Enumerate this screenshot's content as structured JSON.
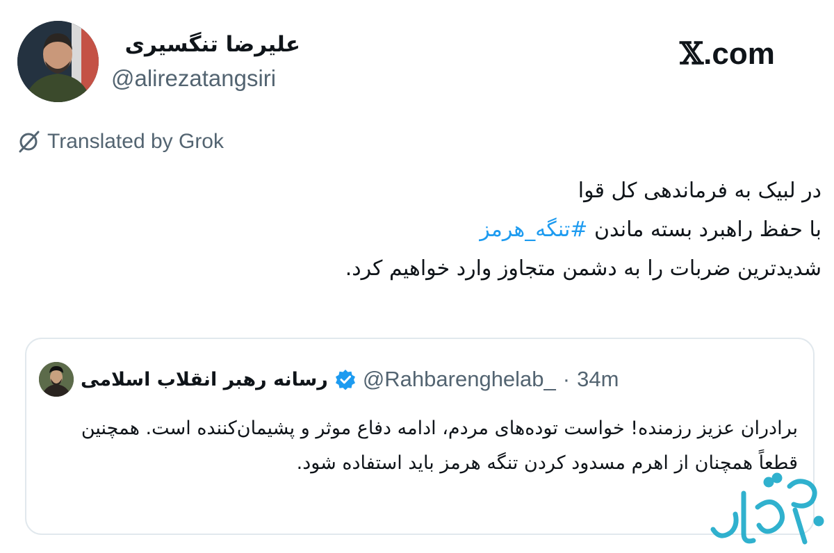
{
  "author": {
    "name": "علیرضا تنگسیری",
    "handle": "@alirezatangsiri"
  },
  "brand": {
    "x_glyph": "𝕏",
    "domain": ".com"
  },
  "translation": {
    "label": "Translated by Grok",
    "icon": "translate-off-icon"
  },
  "tweet": {
    "line1": "در لبیک به فرماندهی کل قوا",
    "line2_before": "با حفظ راهبرد بسته ماندن ",
    "hashtag": "#تنگه_هرمز",
    "line3": "شدیدترین ضربات را  به دشمن متجاوز وارد خواهیم کرد."
  },
  "quote": {
    "name": "رسانه رهبر انقلاب اسلامی",
    "handle": "@Rahbarenghelab_",
    "separator": "·",
    "time": "34m",
    "text": "برادران عزیز رزمنده! خواست توده‌های مردم، ادامه دفاع موثر و پشیمان‌کننده است. همچنین قطعاً همچنان از اهرم مسدود کردن تنگه هرمز باید استفاده شود.",
    "verified_color": "#1d9bf0"
  },
  "colors": {
    "hashtag": "#1d9bf0",
    "secondary_text": "#536471",
    "watermark": "#1aa9c9"
  }
}
